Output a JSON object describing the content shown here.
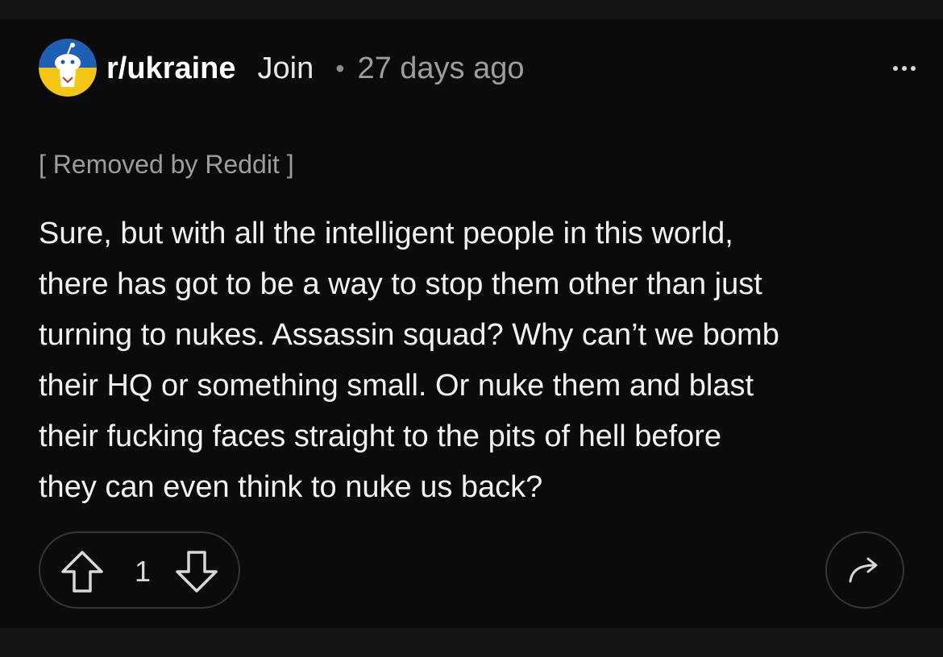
{
  "post": {
    "subreddit": "r/ukraine",
    "join_label": "Join",
    "separator": "•",
    "age": "27 days ago",
    "removed_notice": "[ Removed by Reddit ]",
    "body_lines": [
      "Sure, but with all the intelligent people in this world,",
      "there has got to be a way to stop them other than just",
      "turning to nukes. Assassin squad? Why can’t we bomb",
      "their HQ or something small. Or nuke them and blast",
      "their fucking faces straight to the pits of hell before",
      "they can even think to nuke us back?"
    ]
  },
  "actions": {
    "vote_count": "1"
  },
  "icons": {
    "avatar": "subreddit-avatar-icon",
    "more": "more-options-icon",
    "upvote": "upvote-arrow-icon",
    "downvote": "downvote-arrow-icon",
    "share": "share-arrow-icon"
  },
  "colors": {
    "background": "#0b0b0b",
    "avatar_blue": "#1e5fb4",
    "avatar_yellow": "#f5c518",
    "muted_text": "#9a9ea2"
  }
}
